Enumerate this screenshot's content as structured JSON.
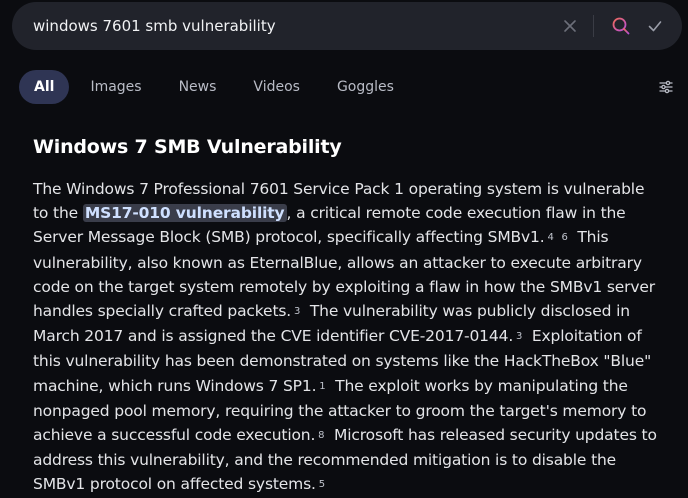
{
  "search": {
    "query": "windows 7601 smb vulnerability",
    "icons": {
      "clear": "close-icon",
      "search": "search-icon",
      "confirm": "check-icon",
      "settings": "sliders-icon"
    },
    "accent_color": "#e0567d"
  },
  "tabs": [
    {
      "label": "All",
      "active": true
    },
    {
      "label": "Images",
      "active": false
    },
    {
      "label": "News",
      "active": false
    },
    {
      "label": "Videos",
      "active": false
    },
    {
      "label": "Goggles",
      "active": false
    }
  ],
  "answer": {
    "title": "Windows 7 SMB Vulnerability",
    "segments": [
      {
        "type": "text",
        "value": "The Windows 7 Professional 7601 Service Pack 1 operating system is vulnerable to the "
      },
      {
        "type": "highlight",
        "value": "MS17-010 vulnerability"
      },
      {
        "type": "text",
        "value": ", a critical remote code execution flaw in the Server Message Block (SMB) protocol, specifically affecting SMBv1."
      },
      {
        "type": "cite",
        "value": "4"
      },
      {
        "type": "cite",
        "value": "6"
      },
      {
        "type": "text",
        "value": "This vulnerability, also known as EternalBlue, allows an attacker to execute arbitrary code on the target system remotely by exploiting a flaw in how the SMBv1 server handles specially crafted packets."
      },
      {
        "type": "cite",
        "value": "3"
      },
      {
        "type": "text",
        "value": "The vulnerability was publicly disclosed in March 2017 and is assigned the CVE identifier CVE-2017-0144."
      },
      {
        "type": "cite",
        "value": "3"
      },
      {
        "type": "text",
        "value": "Exploitation of this vulnerability has been demonstrated on systems like the HackTheBox \"Blue\" machine, which runs Windows 7 SP1."
      },
      {
        "type": "cite",
        "value": "1"
      },
      {
        "type": "text",
        "value": "The exploit works by manipulating the nonpaged pool memory, requiring the attacker to groom the target's memory to achieve a successful code execution."
      },
      {
        "type": "cite",
        "value": "8"
      },
      {
        "type": "text",
        "value": "Microsoft has released security updates to address this vulnerability, and the recommended mitigation is to disable the SMBv1 protocol on affected systems."
      },
      {
        "type": "cite",
        "value": "5"
      }
    ]
  }
}
